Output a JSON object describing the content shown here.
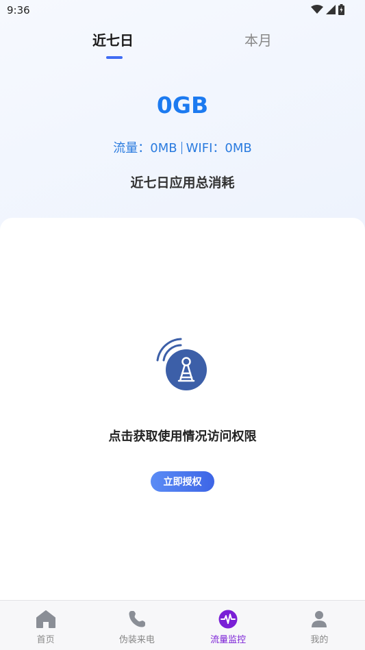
{
  "status_bar": {
    "time": "9:36"
  },
  "tabs": [
    {
      "label": "近七日",
      "active": true
    },
    {
      "label": "本月",
      "active": false
    }
  ],
  "summary": {
    "total": "0GB",
    "cellular_label": "流量：0MB",
    "wifi_label": "WIFI：0MB",
    "subtitle": "近七日应用总消耗"
  },
  "permission": {
    "icon": "signal-tower-icon",
    "message": "点击获取使用情况访问权限",
    "button_label": "立即授权"
  },
  "bottom_nav": [
    {
      "label": "首页",
      "icon": "home-icon",
      "active": false
    },
    {
      "label": "伪装来电",
      "icon": "phone-icon",
      "active": false
    },
    {
      "label": "流量监控",
      "icon": "traffic-monitor-icon",
      "active": true
    },
    {
      "label": "我的",
      "icon": "profile-icon",
      "active": false
    }
  ],
  "colors": {
    "accent": "#3f6cf3",
    "total_text": "#1c7af0",
    "nav_active": "#7a1fd6",
    "tower_blue": "#3c5fa8"
  }
}
